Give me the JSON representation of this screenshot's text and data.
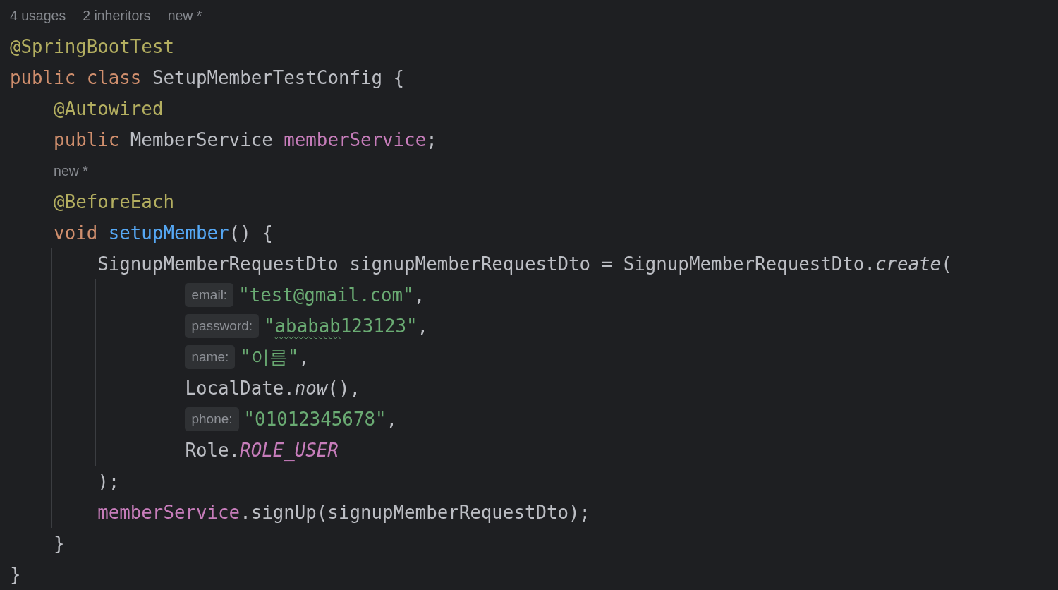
{
  "editor": {
    "lines": [
      {
        "kind": "lens",
        "items": [
          "4 usages",
          "2 inheritors",
          "new *"
        ]
      },
      {
        "kind": "code",
        "tokens": [
          {
            "text": "@SpringBootTest",
            "kind": "annotation"
          }
        ]
      },
      {
        "kind": "code",
        "tokens": [
          {
            "text": "public class",
            "kind": "keyword"
          },
          {
            "text": " SetupMemberTestConfig {",
            "kind": "plain"
          }
        ],
        "children": [
          {
            "kind": "code",
            "tokens": [
              {
                "text": "@Autowired",
                "kind": "annotation"
              }
            ]
          },
          {
            "kind": "code",
            "tokens": [
              {
                "text": "public",
                "kind": "keyword"
              },
              {
                "text": " MemberService ",
                "kind": "plain"
              },
              {
                "text": "memberService",
                "kind": "field"
              },
              {
                "text": ";",
                "kind": "plain"
              }
            ]
          },
          {
            "kind": "lens",
            "items": [
              "new *"
            ]
          },
          {
            "kind": "code",
            "tokens": [
              {
                "text": "@BeforeEach",
                "kind": "annotation"
              }
            ]
          },
          {
            "kind": "code",
            "tokens": [
              {
                "text": "void ",
                "kind": "keyword"
              },
              {
                "text": "setupMember",
                "kind": "method"
              },
              {
                "text": "() {",
                "kind": "plain"
              }
            ],
            "guide": true,
            "children": [
              {
                "kind": "code",
                "tokens": [
                  {
                    "text": "SignupMemberRequestDto signupMemberRequestDto = SignupMemberRequestDto.",
                    "kind": "plain"
                  },
                  {
                    "text": "create",
                    "kind": "static"
                  },
                  {
                    "text": "(",
                    "kind": "plain"
                  }
                ],
                "guide": true,
                "continuation": true,
                "children": [
                  {
                    "kind": "code",
                    "tokens": [
                      {
                        "text": "email:",
                        "kind": "hint"
                      },
                      {
                        "text": "\"test@gmail.com\"",
                        "kind": "string"
                      },
                      {
                        "text": ",",
                        "kind": "plain"
                      }
                    ]
                  },
                  {
                    "kind": "code",
                    "tokens": [
                      {
                        "text": "password:",
                        "kind": "hint"
                      },
                      {
                        "text": "\"",
                        "kind": "string"
                      },
                      {
                        "text": "ababab",
                        "kind": "string",
                        "typo": true
                      },
                      {
                        "text": "123123\"",
                        "kind": "string"
                      },
                      {
                        "text": ",",
                        "kind": "plain"
                      }
                    ]
                  },
                  {
                    "kind": "code",
                    "tokens": [
                      {
                        "text": "name:",
                        "kind": "hint"
                      },
                      {
                        "text": "\"이름\"",
                        "kind": "string"
                      },
                      {
                        "text": ",",
                        "kind": "plain"
                      }
                    ]
                  },
                  {
                    "kind": "code",
                    "tokens": [
                      {
                        "text": "LocalDate.",
                        "kind": "plain"
                      },
                      {
                        "text": "now",
                        "kind": "static"
                      },
                      {
                        "text": "(),",
                        "kind": "plain"
                      }
                    ]
                  },
                  {
                    "kind": "code",
                    "tokens": [
                      {
                        "text": "phone:",
                        "kind": "hint"
                      },
                      {
                        "text": "\"01012345678\"",
                        "kind": "string"
                      },
                      {
                        "text": ",",
                        "kind": "plain"
                      }
                    ]
                  },
                  {
                    "kind": "code",
                    "tokens": [
                      {
                        "text": "Role.",
                        "kind": "plain"
                      },
                      {
                        "text": "ROLE_USER",
                        "kind": "constant"
                      }
                    ]
                  }
                ]
              },
              {
                "kind": "code",
                "tokens": [
                  {
                    "text": ");",
                    "kind": "plain"
                  }
                ]
              },
              {
                "kind": "code",
                "tokens": [
                  {
                    "text": "memberService",
                    "kind": "field"
                  },
                  {
                    "text": ".signUp(signupMemberRequestDto);",
                    "kind": "plain"
                  }
                ]
              }
            ]
          },
          {
            "kind": "code",
            "tokens": [
              {
                "text": "}",
                "kind": "plain"
              }
            ]
          }
        ]
      },
      {
        "kind": "code",
        "tokens": [
          {
            "text": "}",
            "kind": "plain"
          }
        ]
      }
    ]
  }
}
